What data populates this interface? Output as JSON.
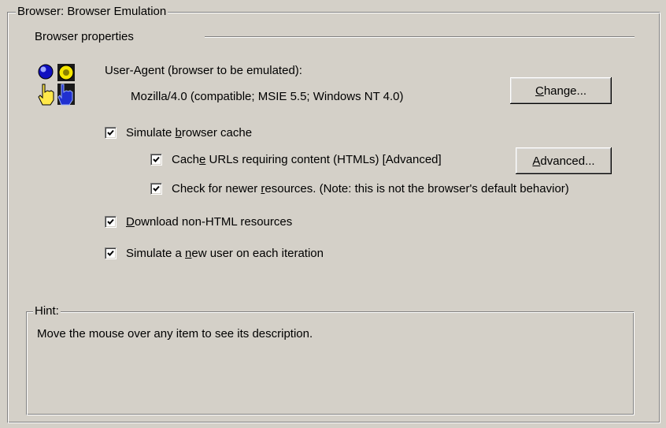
{
  "group": {
    "title": "Browser: Browser Emulation",
    "section_label": "Browser properties"
  },
  "user_agent": {
    "label": "User-Agent (browser to be emulated):",
    "value": "Mozilla/4.0 (compatible; MSIE 5.5; Windows NT 4.0)",
    "icon": "browser-emulation-icon"
  },
  "buttons": {
    "change": {
      "prefix": "",
      "underlined": "C",
      "suffix": "hange..."
    },
    "advanced": {
      "prefix": "",
      "underlined": "A",
      "suffix": "dvanced..."
    }
  },
  "checkboxes": {
    "simulate_cache": {
      "checked": true,
      "prefix": "Simulate ",
      "underlined": "b",
      "suffix": "rowser cache"
    },
    "cache_urls": {
      "checked": true,
      "prefix": "Cach",
      "underlined": "e",
      "suffix": " URLs requiring content (HTMLs) [Advanced]"
    },
    "check_newer": {
      "checked": true,
      "prefix": "Check for newer ",
      "underlined": "r",
      "suffix": "esources. (Note: this is not the browser's default behavior)"
    },
    "download_non_html": {
      "checked": true,
      "prefix": "",
      "underlined": "D",
      "suffix": "ownload non-HTML resources"
    },
    "new_user": {
      "checked": true,
      "prefix": "Simulate a ",
      "underlined": "n",
      "suffix": "ew user on each iteration"
    }
  },
  "hint": {
    "title": "Hint:",
    "text": "Move the mouse over any item to see its description."
  }
}
